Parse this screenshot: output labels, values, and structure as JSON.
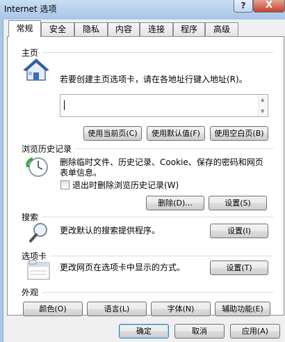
{
  "window": {
    "title": "Internet 选项",
    "help_label": "?",
    "close_label": "X"
  },
  "tabs": [
    {
      "label": "常规",
      "active": true
    },
    {
      "label": "安全"
    },
    {
      "label": "隐私"
    },
    {
      "label": "内容"
    },
    {
      "label": "连接"
    },
    {
      "label": "程序"
    },
    {
      "label": "高级"
    }
  ],
  "home": {
    "heading": "主页",
    "description": "若要创建主页选项卡，请在各地址行键入地址(R)。",
    "address_value": "",
    "use_current": "使用当前页(C)",
    "use_default": "使用默认值(F)",
    "use_blank": "使用空白页(B)"
  },
  "history": {
    "heading": "浏览历史记录",
    "description_line1": "删除临时文件、历史记录、Cookie、保存的密码和网页",
    "description_line2": "表单信息。",
    "delete_on_exit_label": "退出时删除浏览历史记录(W)",
    "delete_on_exit_checked": false,
    "delete_button": "删除(D)...",
    "settings_button": "设置(S)"
  },
  "search": {
    "heading": "搜索",
    "description": "更改默认的搜索提供程序。",
    "settings_button": "设置(I)"
  },
  "tabs_section": {
    "heading": "选项卡",
    "description": "更改网页在选项卡中显示的方式。",
    "settings_button": "设置(T)"
  },
  "appearance": {
    "heading": "外观",
    "colors": "颜色(O)",
    "languages": "语言(L)",
    "fonts": "字体(N)",
    "accessibility": "辅助功能(E)"
  },
  "footer": {
    "ok": "确定",
    "cancel": "取消",
    "apply": "应用(A)"
  }
}
